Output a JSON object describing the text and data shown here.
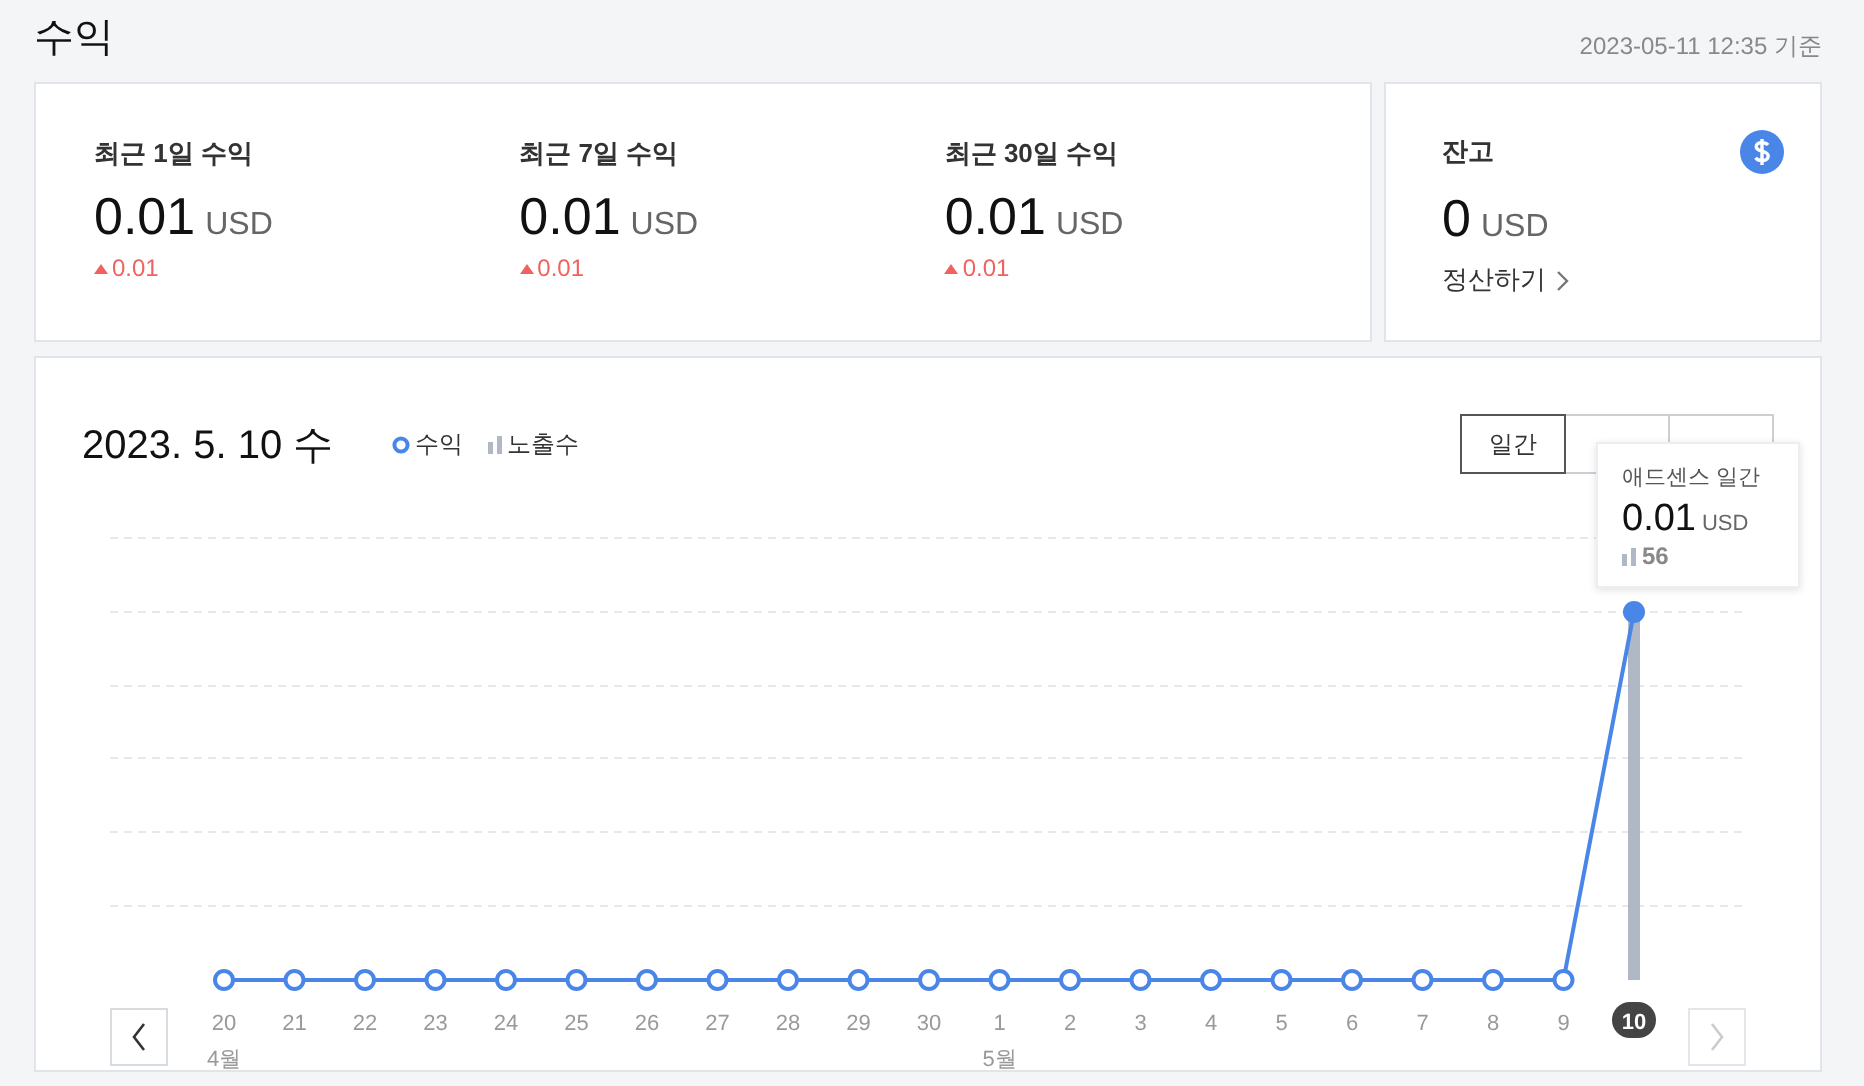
{
  "title": "수익",
  "updated": "2023-05-11 12:35 기준",
  "stats": [
    {
      "label": "최근 1일 수익",
      "value": "0.01",
      "unit": "USD",
      "change": "0.01",
      "rising": true
    },
    {
      "label": "최근 7일 수익",
      "value": "0.01",
      "unit": "USD",
      "change": "0.01",
      "rising": true
    },
    {
      "label": "최근 30일 수익",
      "value": "0.01",
      "unit": "USD",
      "change": "0.01",
      "rising": true
    }
  ],
  "balance": {
    "label": "잔고",
    "value": "0",
    "unit": "USD",
    "link": "정산하기"
  },
  "chart": {
    "date": "2023. 5. 10 수",
    "legend": [
      {
        "label": "수익",
        "kind": "line"
      },
      {
        "label": "노출수",
        "kind": "bar"
      }
    ],
    "tabs": [
      {
        "label": "일간",
        "selected": true
      },
      {
        "selected": false
      },
      {
        "selected": false
      }
    ],
    "tooltip": {
      "title": "애드센스 일간",
      "value": "0.01",
      "unit": "USD",
      "impressions": "56"
    },
    "days": [
      {
        "label": "20",
        "month": "4월",
        "selected": false
      },
      {
        "label": "21",
        "selected": false
      },
      {
        "label": "22",
        "selected": false
      },
      {
        "label": "23",
        "selected": false
      },
      {
        "label": "24",
        "selected": false
      },
      {
        "label": "25",
        "selected": false
      },
      {
        "label": "26",
        "selected": false
      },
      {
        "label": "27",
        "selected": false
      },
      {
        "label": "28",
        "selected": false
      },
      {
        "label": "29",
        "selected": false
      },
      {
        "label": "30",
        "selected": false
      },
      {
        "label": "1",
        "month": "5월",
        "selected": false
      },
      {
        "label": "2",
        "selected": false
      },
      {
        "label": "3",
        "selected": false
      },
      {
        "label": "4",
        "selected": false
      },
      {
        "label": "5",
        "selected": false
      },
      {
        "label": "6",
        "selected": false
      },
      {
        "label": "7",
        "selected": false
      },
      {
        "label": "8",
        "selected": false
      },
      {
        "label": "9",
        "selected": false
      },
      {
        "label": "10",
        "selected": true
      }
    ]
  }
}
